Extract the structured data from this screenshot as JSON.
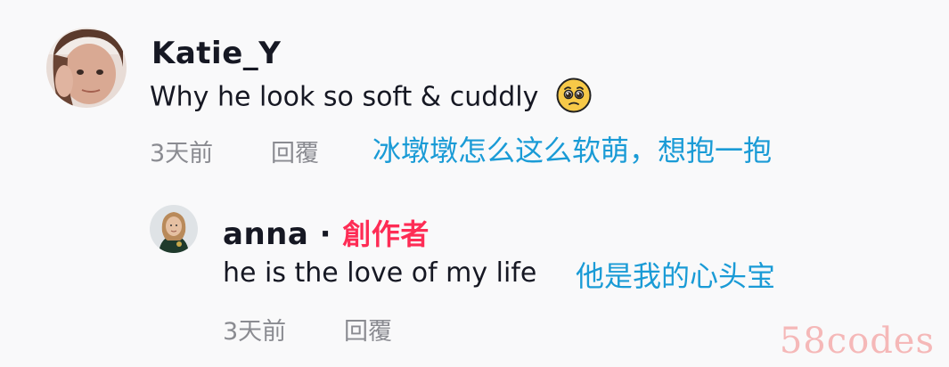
{
  "comments": [
    {
      "username": "Katie_Y",
      "text": "Why he look so soft & cuddly",
      "emoji": "pleading-face",
      "time": "3天前",
      "reply_label": "回覆",
      "translation": "冰墩墩怎么这么软萌，想抱一抱",
      "avatar": "user-photo-katie"
    },
    {
      "username": "anna",
      "separator": "·",
      "creator_tag": "創作者",
      "text": "he is the love of my life",
      "translation": "他是我的心头宝",
      "time": "3天前",
      "reply_label": "回覆",
      "avatar": "user-photo-anna"
    }
  ],
  "watermark": "58codes",
  "colors": {
    "background": "#f9f9fa",
    "text_primary": "#161823",
    "text_secondary": "#8a8b91",
    "translation": "#1a9bd6",
    "creator_tag": "#fe2c55",
    "watermark": "#f5b8b8"
  }
}
